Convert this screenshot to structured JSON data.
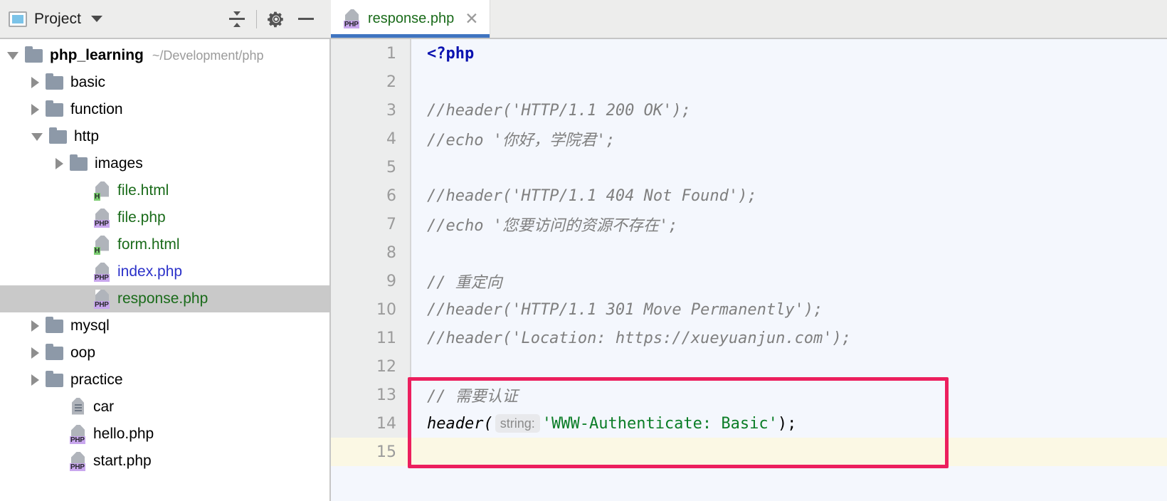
{
  "toolbar": {
    "project_label": "Project",
    "project_icon": "project-window-icon",
    "dropdown_icon": "chevron-down-icon",
    "collapse_all_icon": "collapse-all-icon",
    "settings_icon": "gear-icon",
    "minimize_icon": "minimize-icon"
  },
  "tabs": [
    {
      "title": "response.php",
      "icon": "php-file-icon",
      "badge": "PHP",
      "close_glyph": "✕",
      "active": true
    }
  ],
  "tree": [
    {
      "label": "php_learning",
      "path": "~/Development/php",
      "type": "folder",
      "state": "expanded",
      "depth": 0,
      "bold": true,
      "color": "black"
    },
    {
      "label": "basic",
      "type": "folder",
      "state": "collapsed",
      "depth": 1,
      "color": "black"
    },
    {
      "label": "function",
      "type": "folder",
      "state": "collapsed",
      "depth": 1,
      "color": "black"
    },
    {
      "label": "http",
      "type": "folder",
      "state": "expanded",
      "depth": 1,
      "color": "black"
    },
    {
      "label": "images",
      "type": "folder",
      "state": "collapsed",
      "depth": 2,
      "color": "black"
    },
    {
      "label": "file.html",
      "type": "file",
      "badge": "H",
      "depth": 3,
      "color": "green"
    },
    {
      "label": "file.php",
      "type": "file",
      "badge": "PHP",
      "depth": 3,
      "color": "green"
    },
    {
      "label": "form.html",
      "type": "file",
      "badge": "H",
      "depth": 3,
      "color": "green"
    },
    {
      "label": "index.php",
      "type": "file",
      "badge": "PHP",
      "depth": 3,
      "color": "blue"
    },
    {
      "label": "response.php",
      "type": "file",
      "badge": "PHP",
      "depth": 3,
      "color": "green",
      "selected": true
    },
    {
      "label": "mysql",
      "type": "folder",
      "state": "collapsed",
      "depth": 1,
      "color": "black"
    },
    {
      "label": "oop",
      "type": "folder",
      "state": "collapsed",
      "depth": 1,
      "color": "black"
    },
    {
      "label": "practice",
      "type": "folder",
      "state": "collapsed",
      "depth": 1,
      "color": "black"
    },
    {
      "label": "car",
      "type": "textfile",
      "depth": 2,
      "color": "black"
    },
    {
      "label": "hello.php",
      "type": "file",
      "badge": "PHP",
      "depth": 2,
      "color": "black"
    },
    {
      "label": "start.php",
      "type": "file",
      "badge": "PHP",
      "depth": 2,
      "color": "black"
    }
  ],
  "editor": {
    "filename": "response.php",
    "line_numbers": [
      "1",
      "2",
      "3",
      "4",
      "5",
      "6",
      "7",
      "8",
      "9",
      "10",
      "11",
      "12",
      "13",
      "14",
      "15"
    ],
    "current_line": 15,
    "lines": [
      {
        "n": "1",
        "tokens": [
          {
            "t": "php",
            "v": "<?php"
          }
        ]
      },
      {
        "n": "2",
        "tokens": []
      },
      {
        "n": "3",
        "tokens": [
          {
            "t": "cmt",
            "v": "//header('HTTP/1.1 200 OK');"
          }
        ]
      },
      {
        "n": "4",
        "tokens": [
          {
            "t": "cmt",
            "v": "//echo '你好，学院君';"
          }
        ]
      },
      {
        "n": "5",
        "tokens": []
      },
      {
        "n": "6",
        "tokens": [
          {
            "t": "cmt",
            "v": "//header('HTTP/1.1 404 Not Found');"
          }
        ]
      },
      {
        "n": "7",
        "tokens": [
          {
            "t": "cmt",
            "v": "//echo '您要访问的资源不存在';"
          }
        ]
      },
      {
        "n": "8",
        "tokens": []
      },
      {
        "n": "9",
        "tokens": [
          {
            "t": "cmt",
            "v": "// 重定向"
          }
        ]
      },
      {
        "n": "10",
        "tokens": [
          {
            "t": "cmt",
            "v": "//header('HTTP/1.1 301 Move Permanently');"
          }
        ]
      },
      {
        "n": "11",
        "tokens": [
          {
            "t": "cmt",
            "v": "//header('Location: "
          },
          {
            "t": "link",
            "v": "https://xueyuanjun.com"
          },
          {
            "t": "cmt",
            "v": "');"
          }
        ]
      },
      {
        "n": "12",
        "tokens": []
      },
      {
        "n": "13",
        "tokens": [
          {
            "t": "cmt",
            "v": "// 需要认证"
          }
        ]
      },
      {
        "n": "14",
        "tokens": [
          {
            "t": "fn",
            "v": "header("
          },
          {
            "t": "hint",
            "v": "string:"
          },
          {
            "t": "str",
            "v": "'WWW-Authenticate: Basic'"
          },
          {
            "t": "plain",
            "v": ");"
          }
        ]
      },
      {
        "n": "15",
        "tokens": []
      }
    ]
  },
  "annotation": {
    "name": "red-highlight-rectangle",
    "color": "#ec1f5e",
    "covers_lines": "13-15"
  },
  "colors": {
    "accent_tab_underline": "#3f74c0",
    "toolbar_bg": "#ededec",
    "editor_bg": "#f4f7fd",
    "gutter_bg": "#eceded",
    "current_line_bg": "#fbf8e4",
    "selection_bg": "#c9c9c9",
    "string_green": "#0b7d26",
    "comment_grey": "#7f7f7f",
    "keyword_blue": "#0b12b0"
  }
}
